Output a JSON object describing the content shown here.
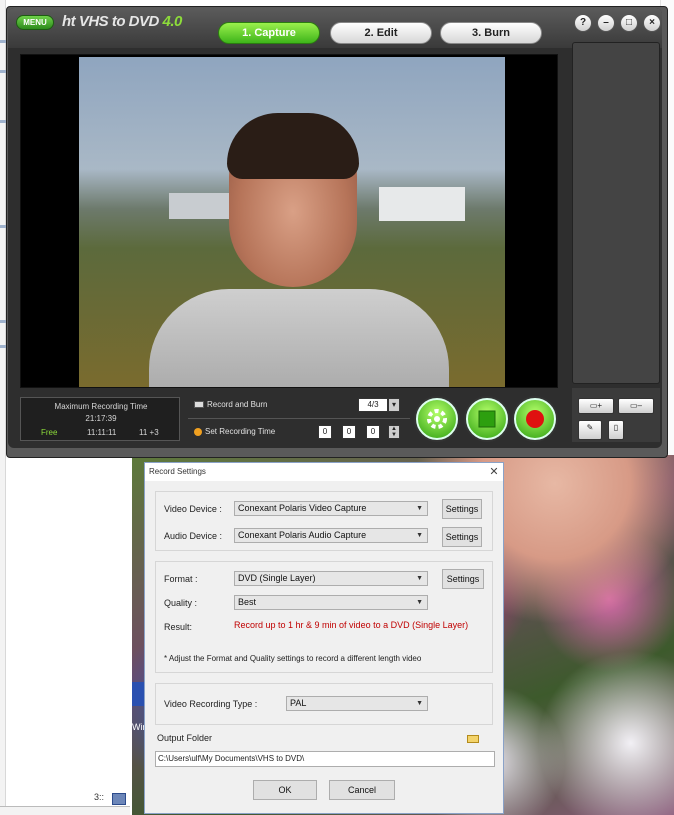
{
  "app": {
    "menu_label": "MENU",
    "logo_prefix": "ht",
    "logo_text": "VHS to DVD",
    "logo_version": "4.0",
    "tabs": [
      {
        "label": "1. Capture",
        "active": true
      },
      {
        "label": "2. Edit",
        "active": false
      },
      {
        "label": "3. Burn",
        "active": false
      }
    ],
    "window_buttons": {
      "help": "?",
      "minimize": "–",
      "maximize": "□",
      "close": "×"
    },
    "recording": {
      "title": "Maximum Recording Time",
      "time": "21:17:39",
      "free_label": "Free",
      "free_value": "11:11:11",
      "size_value": "11 +3"
    },
    "controls": {
      "record_and_burn_label": "Record and Burn",
      "set_recording_time_label": "Set Recording Time",
      "quality_value": "4/3",
      "time_h": "0",
      "time_m": "0",
      "time_s": "0"
    },
    "tools": {
      "add_label": "▭+",
      "remove_label": "▭–"
    }
  },
  "dialog": {
    "title": "Record Settings",
    "video_device_label": "Video Device :",
    "video_device_value": "Conexant Polaris Video Capture",
    "audio_device_label": "Audio Device :",
    "audio_device_value": "Conexant Polaris Audio Capture",
    "settings_label": "Settings",
    "format_label": "Format :",
    "format_value": "DVD (Single Layer)",
    "quality_label": "Quality :",
    "quality_value": "Best",
    "result_label": "Result:",
    "result_text": "Record up to 1 hr & 9 min of video to a DVD (Single Layer)",
    "hint_text": "* Adjust the Format and Quality settings to record a different length video",
    "video_recording_type_label": "Video Recording Type :",
    "video_recording_type_value": "PAL",
    "output_folder_label": "Output Folder",
    "output_folder_value": "C:\\Users\\ulf\\My Documents\\VHS to DVD\\",
    "ok_label": "OK",
    "cancel_label": "Cancel"
  },
  "desktop": {
    "icon_label": "Win",
    "taskbar_text": "3::"
  },
  "colors": {
    "accent_green": "#3eb51a",
    "result_red": "#c00000",
    "app_dark": "#2e2e2e"
  }
}
